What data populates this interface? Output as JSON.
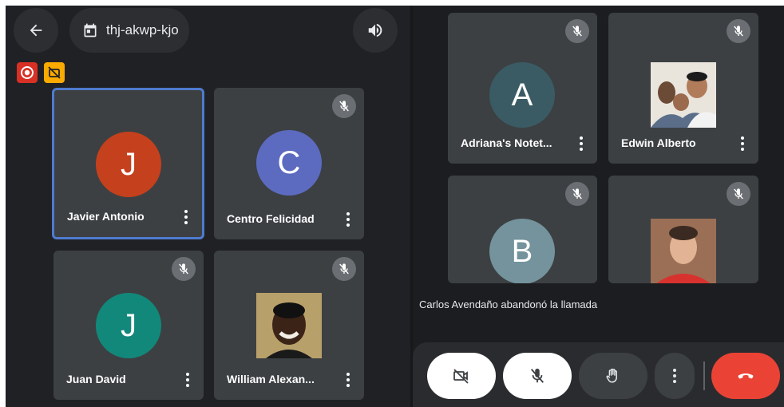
{
  "meeting": {
    "code": "thj-akwp-kjo"
  },
  "header": {
    "back_icon": "arrow-left-icon",
    "calendar_icon": "calendar-icon",
    "speaker_icon": "speaker-icon"
  },
  "indicators": {
    "recording_color": "#d93025",
    "camera_off_color": "#f9ab00"
  },
  "left_participants": [
    {
      "name": "Javier Antonio",
      "initial": "J",
      "avatar_color": "#c5401c",
      "active": true
    },
    {
      "name": "Centro Felicidad",
      "initial": "C",
      "avatar_color": "#5c6bc0",
      "muted": true
    },
    {
      "name": "Juan David",
      "initial": "J",
      "avatar_color": "#12887a",
      "muted": true
    },
    {
      "name": "William Alexan...",
      "photo": "photo-avatar",
      "muted": true
    }
  ],
  "right_participants": [
    {
      "name": "Adriana's Notet...",
      "initial": "A",
      "avatar_color": "#3b5b64",
      "muted": true
    },
    {
      "name": "Edwin Alberto",
      "photo": "photo-avatar",
      "muted": true
    },
    {
      "name": "",
      "initial": "B",
      "avatar_color": "#74939c",
      "muted": true
    },
    {
      "name": "",
      "photo": "photo-avatar",
      "muted": true
    }
  ],
  "notice": "Carlos Avendaño abandonó la llamada",
  "controls": {
    "camera": "camera-off-icon",
    "mic": "mic-off-icon",
    "hand": "raise-hand-icon",
    "more": "more-options-icon",
    "leave": "end-call-icon",
    "leave_color": "#ea4335"
  }
}
